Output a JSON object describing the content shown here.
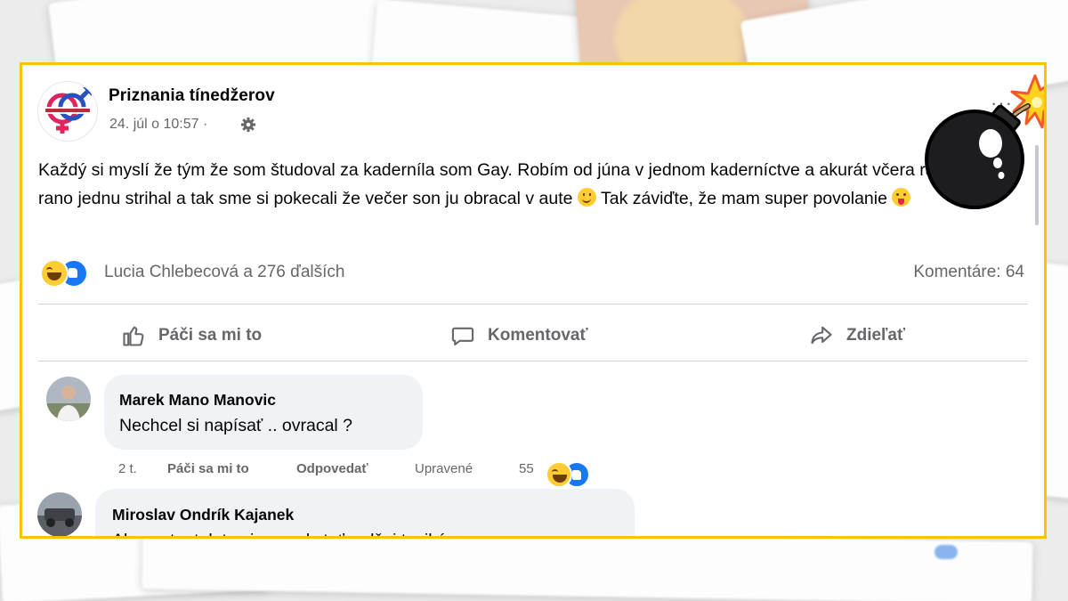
{
  "post": {
    "page_name": "Priznania tínedžerov",
    "timestamp": "24. júl o 10:57 ·",
    "text_part1": "Každý si myslí že tým že som študoval za kaderníla som Gay. Robím od júna v jednom kaderníctve a akurát včera ráno som rano jednu strihal a tak sme si pokecali že večer son ju obracal v aute ",
    "text_part2": " Tak záviďte, že mam super povolanie ",
    "more_label": "···"
  },
  "reactions": {
    "names": "Lucia Chlebecová a 276 ďalších",
    "comments": "Komentáre: 64"
  },
  "actions": {
    "like": "Páči sa mi to",
    "comment": "Komentovať",
    "share": "Zdieľať"
  },
  "comments": [
    {
      "author": "Marek Mano Manovic",
      "text": "Nechcel si napísať .. ovracal ?",
      "time": "2 t.",
      "like_label": "Páči sa mi to",
      "reply_label": "Odpovedať",
      "edited_label": "Upravené",
      "reaction_count": "55"
    },
    {
      "author": "Miroslav Ondrík Kajanek",
      "text": "Ak v aute, tak to si sa mal stať radšej taxikárom..."
    }
  ],
  "colors": {
    "frame": "#f6c400",
    "link_blue": "#1877f2",
    "muted": "#65676b"
  },
  "icons": [
    "gear-icon",
    "thumbs-up-icon",
    "comment-icon",
    "share-icon",
    "haha-reaction-icon",
    "like-reaction-icon",
    "bomb-icon"
  ]
}
